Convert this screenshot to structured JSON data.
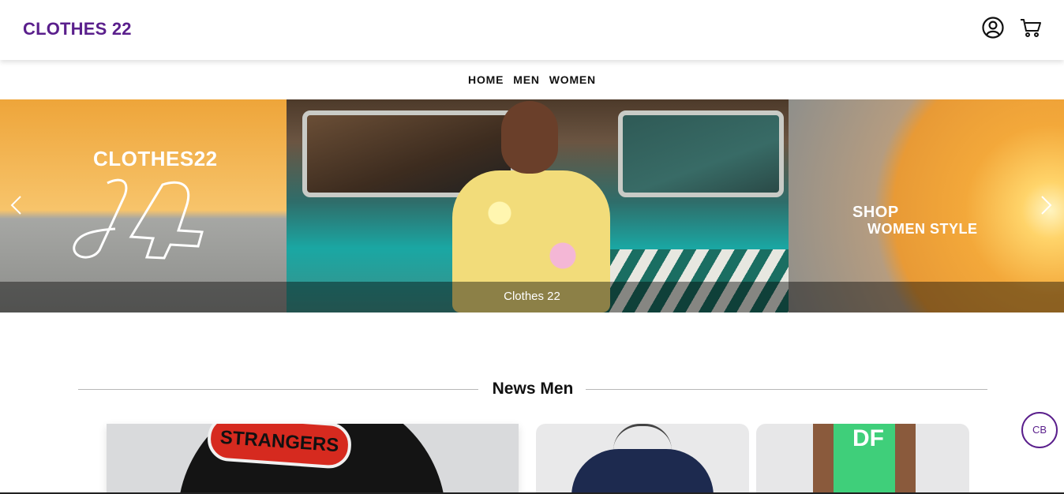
{
  "header": {
    "logo": "CLOTHES 22",
    "icons": [
      "user-account-icon",
      "shopping-cart-icon"
    ]
  },
  "nav": {
    "items": [
      {
        "label": "HOME"
      },
      {
        "label": "MEN"
      },
      {
        "label": "WOMEN"
      }
    ]
  },
  "hero": {
    "left_text": "CLOTHES22",
    "right_text_1": "SHOP",
    "right_text_2": "WOMEN STYLE",
    "caption": "Clothes 22",
    "prev_icon": "chevron-left-icon",
    "next_icon": "chevron-right-icon"
  },
  "section": {
    "title": "News Men"
  },
  "products": {
    "card1_print": "STRANGERS",
    "card3_print": "DF"
  },
  "floating": {
    "badge": "CB"
  },
  "colors": {
    "brand": "#5a1f8c",
    "text": "#111111"
  }
}
